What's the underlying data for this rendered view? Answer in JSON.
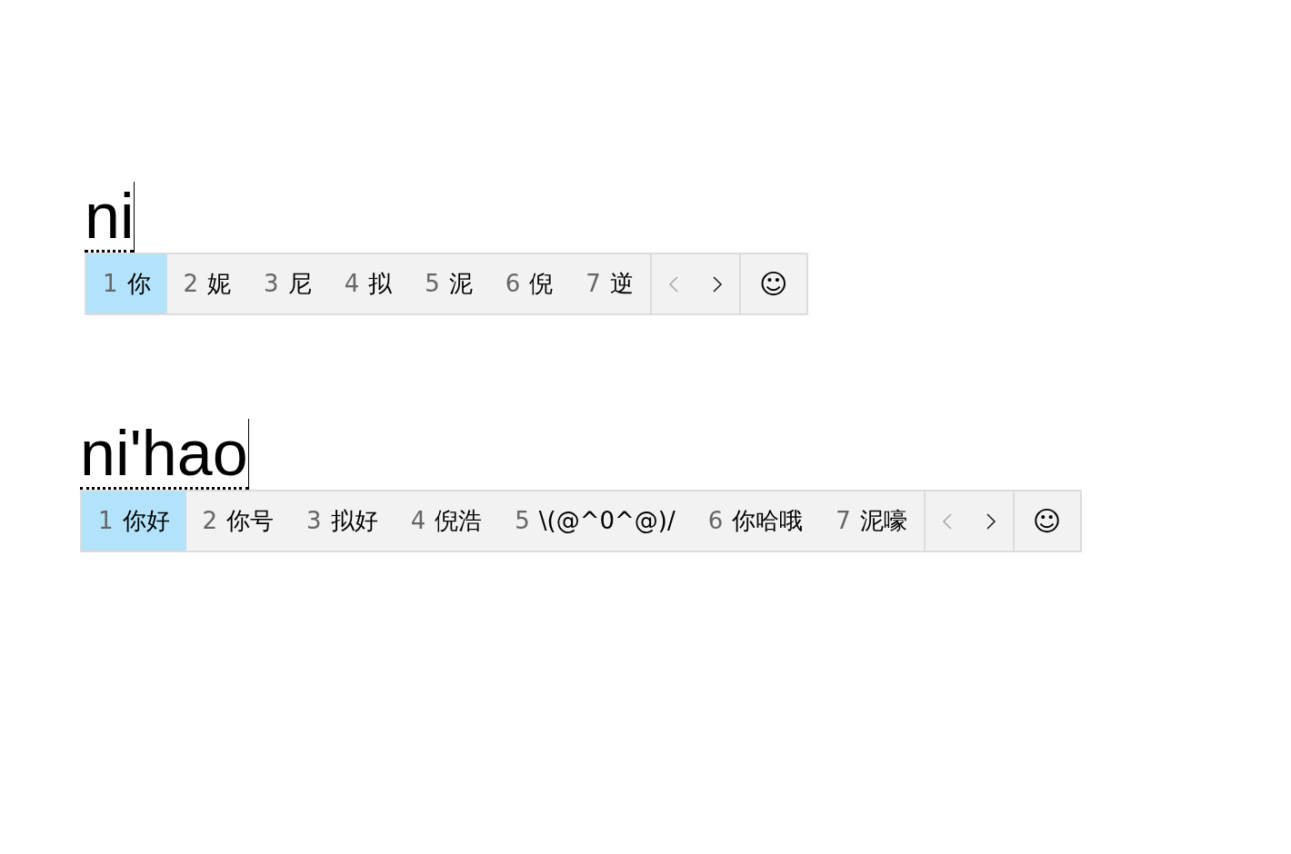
{
  "sessions": [
    {
      "composition": "ni",
      "candidates": [
        {
          "number": "1",
          "text": "你",
          "selected": true
        },
        {
          "number": "2",
          "text": "妮",
          "selected": false
        },
        {
          "number": "3",
          "text": "尼",
          "selected": false
        },
        {
          "number": "4",
          "text": "拟",
          "selected": false
        },
        {
          "number": "5",
          "text": "泥",
          "selected": false
        },
        {
          "number": "6",
          "text": "倪",
          "selected": false
        },
        {
          "number": "7",
          "text": "逆",
          "selected": false
        }
      ],
      "prev_page": {
        "disabled": true
      },
      "next_page": {
        "disabled": false
      },
      "emoji_button": "☺"
    },
    {
      "composition": "ni'hao",
      "candidates": [
        {
          "number": "1",
          "text": "你好",
          "selected": true
        },
        {
          "number": "2",
          "text": "你号",
          "selected": false
        },
        {
          "number": "3",
          "text": "拟好",
          "selected": false
        },
        {
          "number": "4",
          "text": "倪浩",
          "selected": false
        },
        {
          "number": "5",
          "text": "\\(@^0^@)/",
          "selected": false
        },
        {
          "number": "6",
          "text": "你哈哦",
          "selected": false
        },
        {
          "number": "7",
          "text": "泥嚎",
          "selected": false
        }
      ],
      "prev_page": {
        "disabled": true
      },
      "next_page": {
        "disabled": false
      },
      "emoji_button": "☺"
    }
  ]
}
